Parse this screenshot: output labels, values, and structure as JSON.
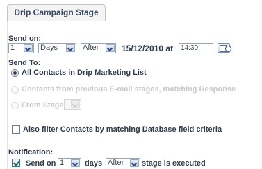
{
  "tab": {
    "title": "Drip Campaign Stage"
  },
  "send_on": {
    "label": "Send on:",
    "count": "1",
    "unit": "Days",
    "relation": "After",
    "date": "15/12/2010",
    "at_label": "at",
    "time": "14:30",
    "calendar_icon": "calendar-clock-icon"
  },
  "send_to": {
    "label": "Send To:",
    "options": [
      {
        "label": "All Contacts in Drip Marketing List",
        "selected": true,
        "enabled": true
      },
      {
        "label": "Contacts from previous E-mail stages, matching Response",
        "selected": false,
        "enabled": false
      },
      {
        "label": "From Stage",
        "selected": false,
        "enabled": false
      }
    ],
    "from_stage_value": ""
  },
  "filter": {
    "label": "Also filter Contacts by matching Database field criteria",
    "checked": false
  },
  "notification": {
    "label": "Notification:",
    "checked": true,
    "send_on_label": "Send on",
    "count": "1",
    "unit_label": "days",
    "relation": "After",
    "suffix": "stage is executed"
  }
}
